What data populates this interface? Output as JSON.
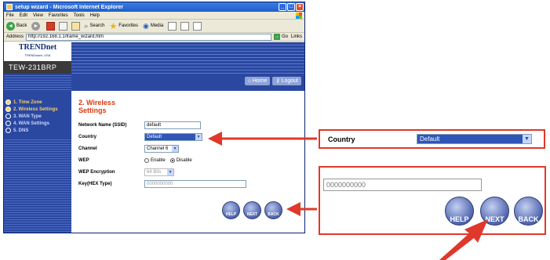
{
  "browser": {
    "title": "setup wizard - Microsoft Internet Explorer",
    "menu": [
      "File",
      "Edit",
      "View",
      "Favorites",
      "Tools",
      "Help"
    ],
    "toolbar": {
      "back": "Back",
      "search": "Search",
      "favorites": "Favorites",
      "media": "Media"
    },
    "address_label": "Address",
    "address": "http://192.168.1.1/frame_wizard.htm",
    "go": "Go",
    "links": "Links"
  },
  "brand": {
    "logo": "TRENDnet",
    "tagline": "TRENDware, USA",
    "model": "TEW-231BRP"
  },
  "nav": {
    "home": "Home",
    "logout": "Logout"
  },
  "steps": [
    {
      "label": "1. Time Zone",
      "done": true
    },
    {
      "label": "2. Wireless Settings",
      "done": true
    },
    {
      "label": "3. WAN Type",
      "done": false
    },
    {
      "label": "4. WAN Settings",
      "done": false
    },
    {
      "label": "5. DNS",
      "done": false
    }
  ],
  "form": {
    "title_line1": "2. Wireless",
    "title_line2": "Settings",
    "ssid_label": "Network Name (SSID)",
    "ssid_value": "default",
    "country_label": "Country",
    "country_value": "Default",
    "channel_label": "Channel",
    "channel_value": "Channel 6",
    "wep_label": "WEP",
    "wep_enable": "Enable",
    "wep_disable": "Disable",
    "wep_selected": "Disable",
    "encryption_label": "WEP Encryption",
    "encryption_value": "64 Bits",
    "key_label": "Key(HEX Type)",
    "key_value": "0000000000"
  },
  "buttons": {
    "help": "HELP",
    "next": "NEXT",
    "back": "BACK"
  },
  "callouts": {
    "country_label": "Country",
    "country_value": "Default",
    "key_value": "0000000000",
    "help": "HELP",
    "next": "NEXT",
    "back": "BACK"
  },
  "colors": {
    "arrow": "#e0382a",
    "title_bar": "#2f6fd8",
    "nav_blue": "#2b48a0",
    "section_title": "#d93a13"
  }
}
